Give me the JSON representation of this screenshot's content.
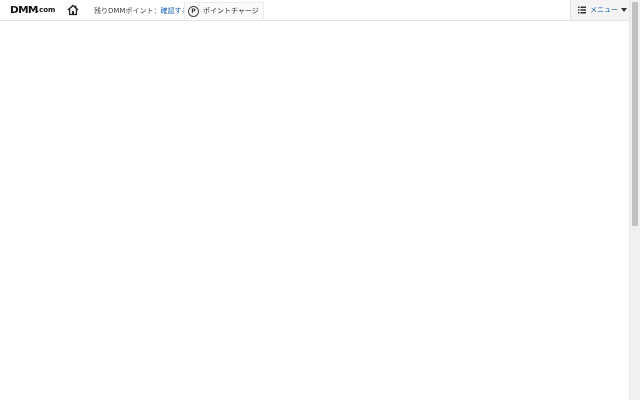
{
  "header": {
    "logo": {
      "main": "DMM",
      "suffix": ".com"
    },
    "home_icon": "home-icon",
    "points": {
      "label": "残りDMMポイント：",
      "link": "確認する"
    },
    "charge": {
      "icon_letter": "P",
      "label": "ポイントチャージ"
    },
    "menu": {
      "label": "メニュー",
      "link_color": "#1a5fb4"
    }
  }
}
